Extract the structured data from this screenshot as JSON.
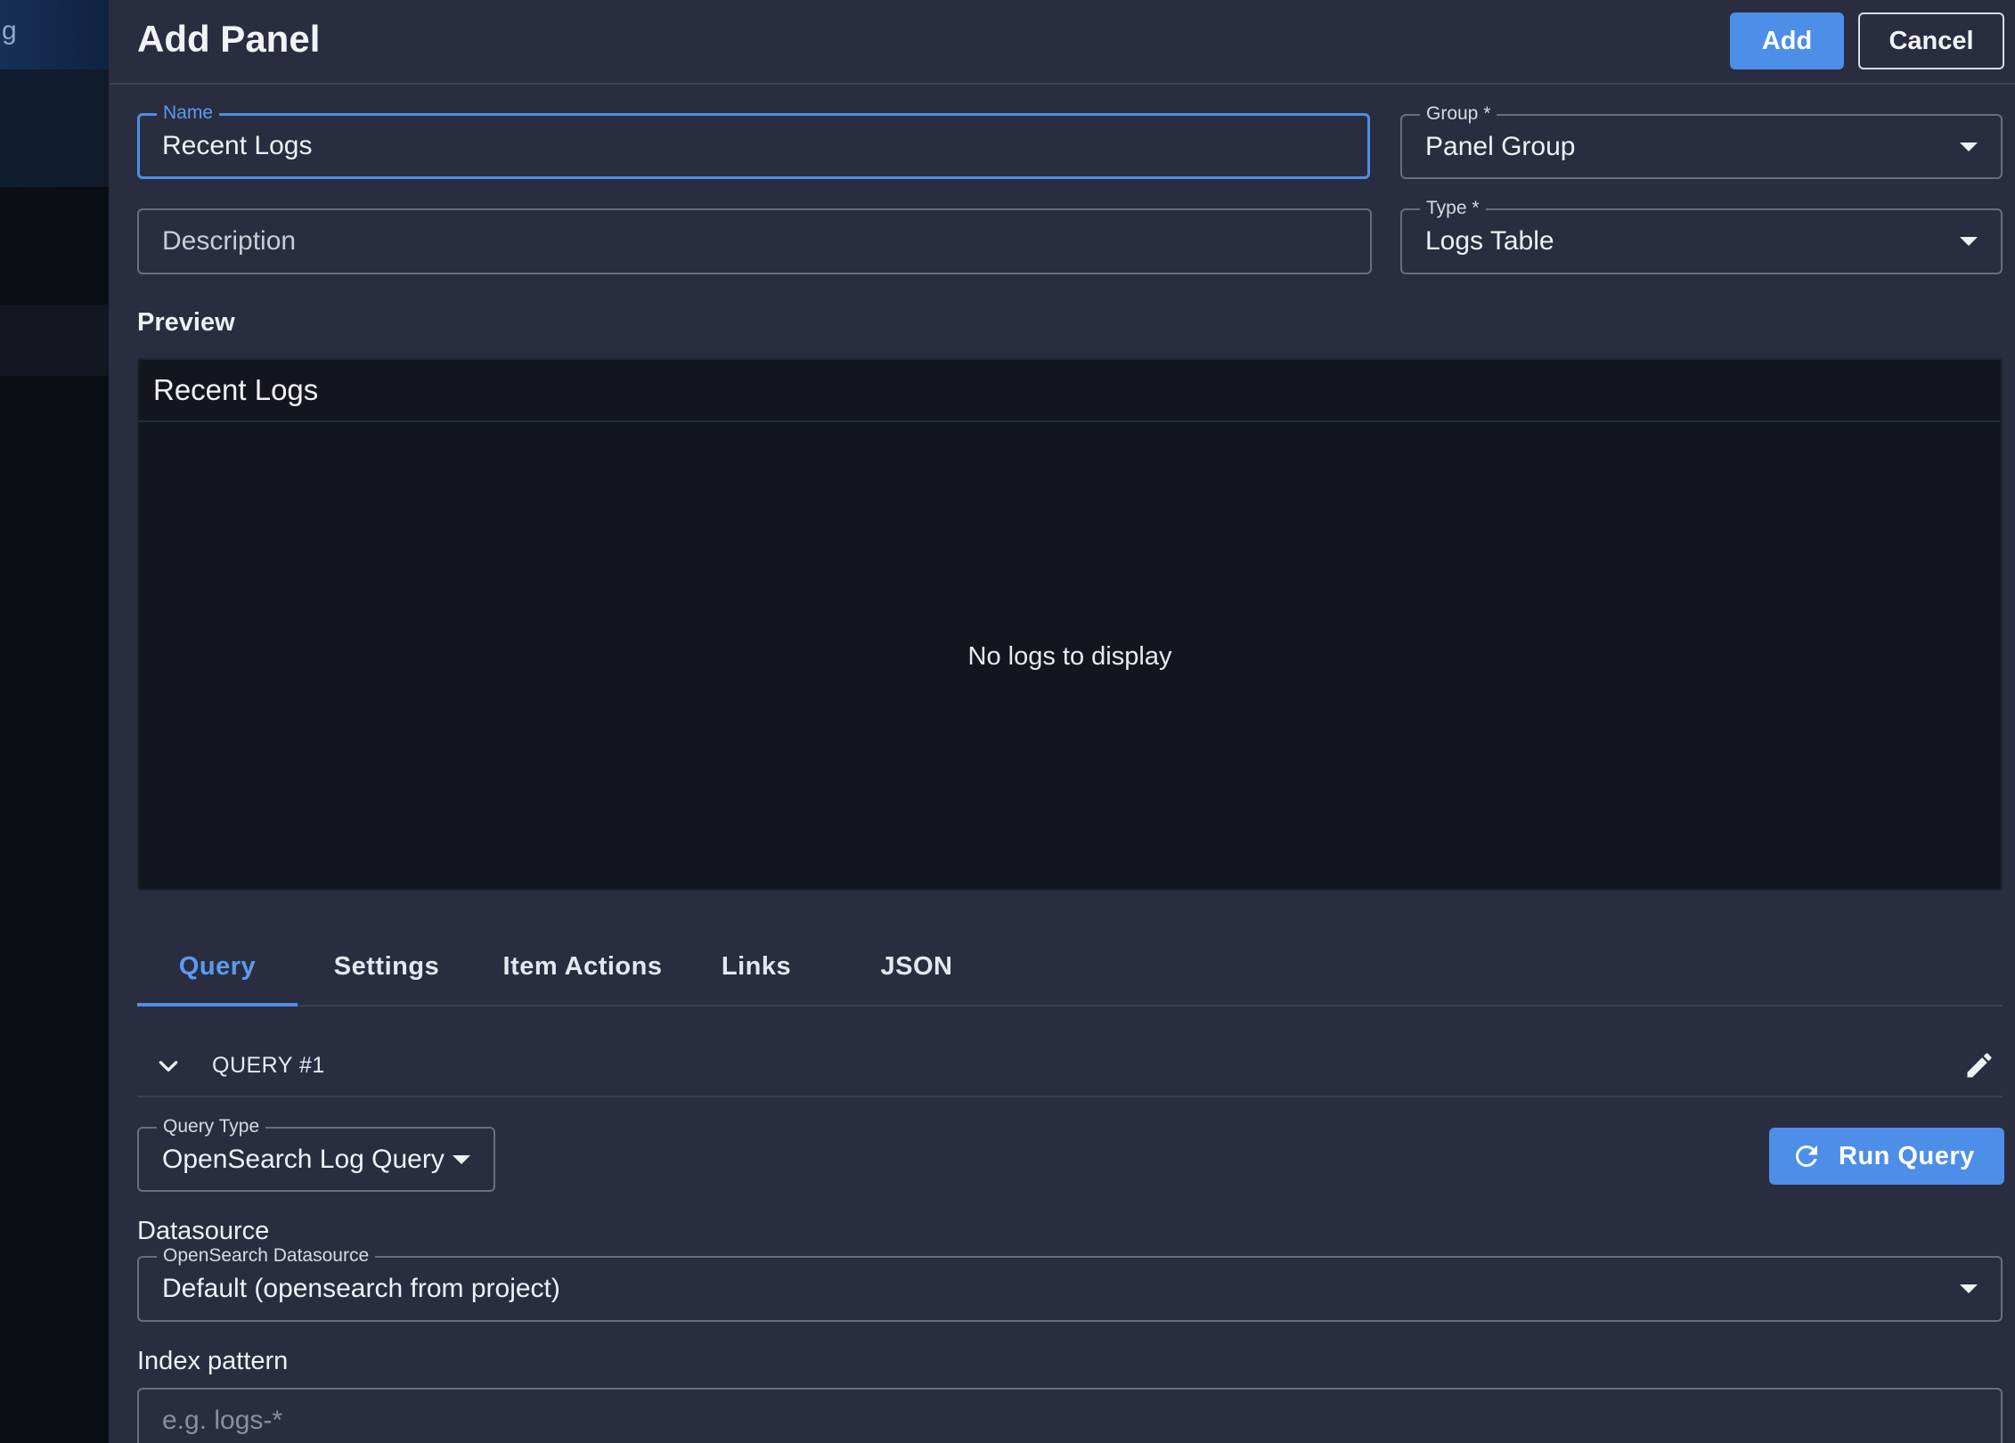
{
  "backdrop": {
    "partial_text": "g"
  },
  "drawer": {
    "title": "Add Panel",
    "add_label": "Add",
    "cancel_label": "Cancel"
  },
  "form": {
    "name": {
      "label": "Name",
      "value": "Recent Logs"
    },
    "group": {
      "label": "Group *",
      "value": "Panel Group"
    },
    "description": {
      "placeholder": "Description"
    },
    "type": {
      "label": "Type *",
      "value": "Logs Table"
    }
  },
  "preview": {
    "section_label": "Preview",
    "panel_title": "Recent Logs",
    "empty_message": "No logs to display"
  },
  "tabs": [
    {
      "label": "Query",
      "active": true
    },
    {
      "label": "Settings",
      "active": false
    },
    {
      "label": "Item Actions",
      "active": false
    },
    {
      "label": "Links",
      "active": false
    },
    {
      "label": "JSON",
      "active": false
    }
  ],
  "query": {
    "header_label": "QUERY #1",
    "query_type": {
      "label": "Query Type",
      "value": "OpenSearch Log Query"
    },
    "run_label": "Run Query",
    "datasource_section": "Datasource",
    "datasource": {
      "label": "OpenSearch Datasource",
      "value": "Default (opensearch from project)"
    },
    "index_section": "Index pattern",
    "index_placeholder": "e.g. logs-*"
  },
  "icons": {
    "chevron": "chevron-down-icon",
    "edit": "pencil-icon",
    "refresh": "refresh-icon",
    "dropdown": "caret-down-icon"
  },
  "colors": {
    "accent": "#4d8ee8",
    "drawer_bg": "#2a2d40",
    "preview_bg": "#13161f"
  }
}
